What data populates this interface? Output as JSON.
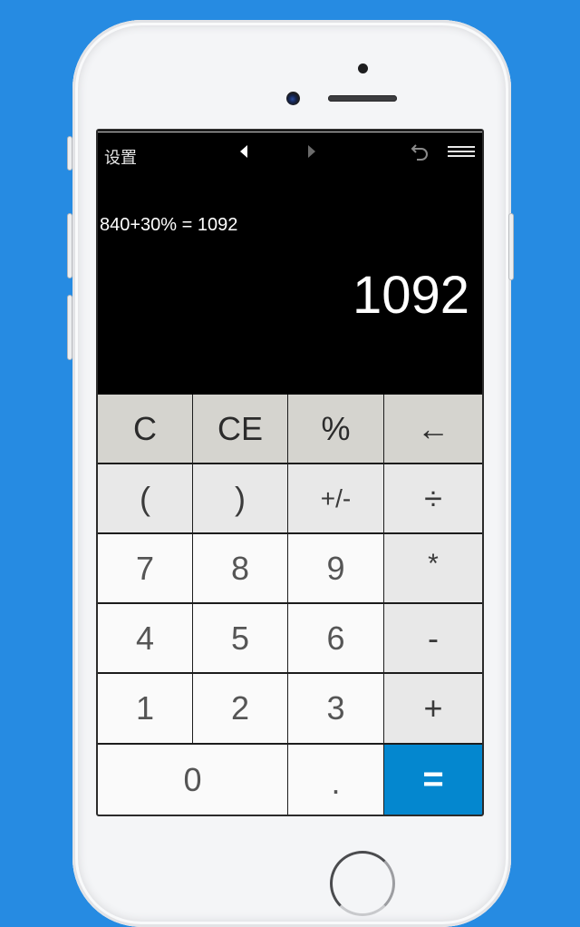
{
  "app": {
    "topbar": {
      "settings_label": "设置",
      "back_icon": "triangle-left-icon",
      "forward_icon": "triangle-right-icon",
      "undo_icon": "undo-icon",
      "menu_icon": "menu-icon"
    },
    "display": {
      "expression": "840+30% = 1092",
      "result": "1092"
    },
    "keypad": {
      "rows": [
        [
          {
            "label": "C",
            "type": "fn"
          },
          {
            "label": "CE",
            "type": "fn"
          },
          {
            "label": "%",
            "type": "fn"
          },
          {
            "label": "←",
            "type": "fn"
          }
        ],
        [
          {
            "label": "(",
            "type": "op"
          },
          {
            "label": ")",
            "type": "op"
          },
          {
            "label": "+/-",
            "type": "op"
          },
          {
            "label": "÷",
            "type": "op"
          }
        ],
        [
          {
            "label": "7",
            "type": "num"
          },
          {
            "label": "8",
            "type": "num"
          },
          {
            "label": "9",
            "type": "num"
          },
          {
            "label": "*",
            "type": "op"
          }
        ],
        [
          {
            "label": "4",
            "type": "num"
          },
          {
            "label": "5",
            "type": "num"
          },
          {
            "label": "6",
            "type": "num"
          },
          {
            "label": "-",
            "type": "op"
          }
        ],
        [
          {
            "label": "1",
            "type": "num"
          },
          {
            "label": "2",
            "type": "num"
          },
          {
            "label": "3",
            "type": "num"
          },
          {
            "label": "+",
            "type": "op"
          }
        ],
        [
          {
            "label": "0",
            "type": "num"
          },
          {
            "label": ".",
            "type": "num"
          },
          {
            "label": "=",
            "type": "eq"
          }
        ]
      ]
    },
    "colors": {
      "background": "#268be2",
      "equals_key": "#0487cf",
      "function_key": "#d5d4cf",
      "operator_key": "#e8e8e8",
      "number_key": "#fafafa"
    }
  }
}
